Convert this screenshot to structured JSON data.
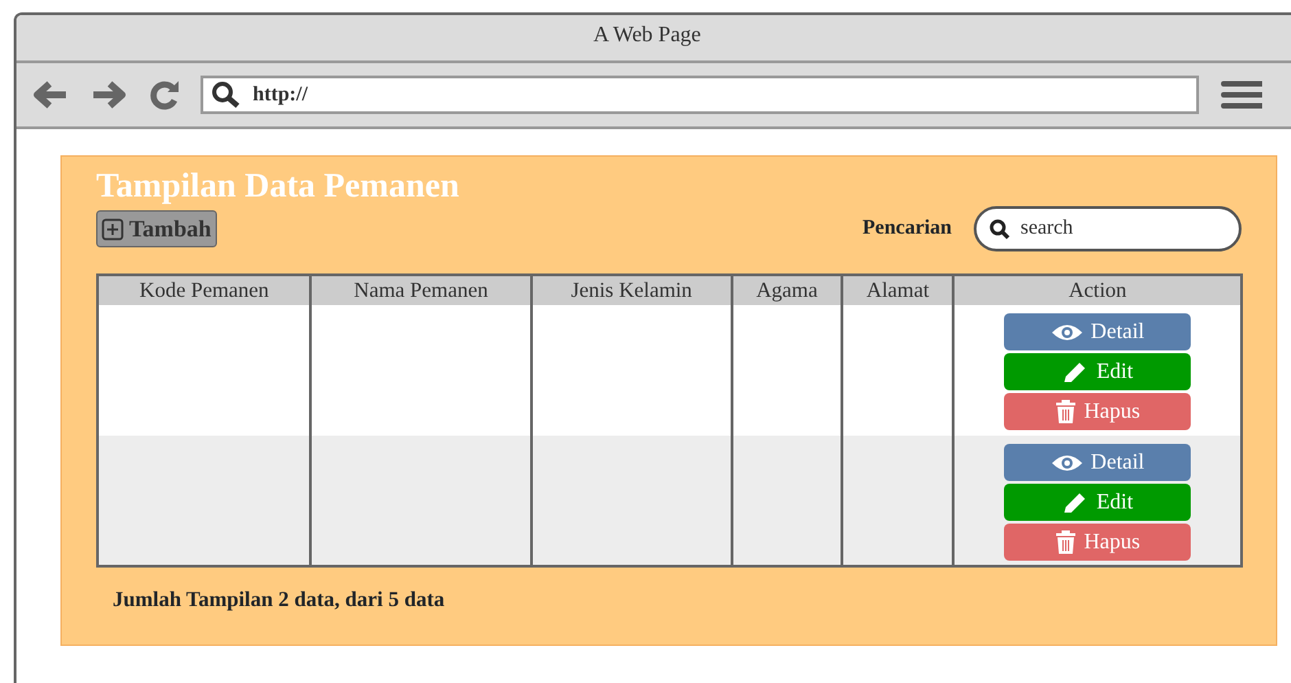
{
  "window": {
    "title": "A Web Page"
  },
  "toolbar": {
    "address": "http://"
  },
  "panel": {
    "title": "Tampilan Data Pemanen",
    "add_button": "Tambah",
    "search_label": "Pencarian",
    "search": {
      "placeholder": "search"
    }
  },
  "table": {
    "columns": [
      "Kode Pemanen",
      "Nama Pemanen",
      "Jenis Kelamin",
      "Agama",
      "Alamat",
      "Action"
    ],
    "rows": [
      {
        "actions": [
          {
            "kind": "view",
            "label": "Detail"
          },
          {
            "kind": "edit",
            "label": "Edit"
          },
          {
            "kind": "delete",
            "label": "Hapus"
          }
        ]
      },
      {
        "actions": [
          {
            "kind": "view",
            "label": "Detail"
          },
          {
            "kind": "edit",
            "label": "Edit"
          },
          {
            "kind": "delete",
            "label": "Hapus"
          }
        ]
      }
    ]
  },
  "footer": "Jumlah Tampilan 2 data, dari 5 data"
}
